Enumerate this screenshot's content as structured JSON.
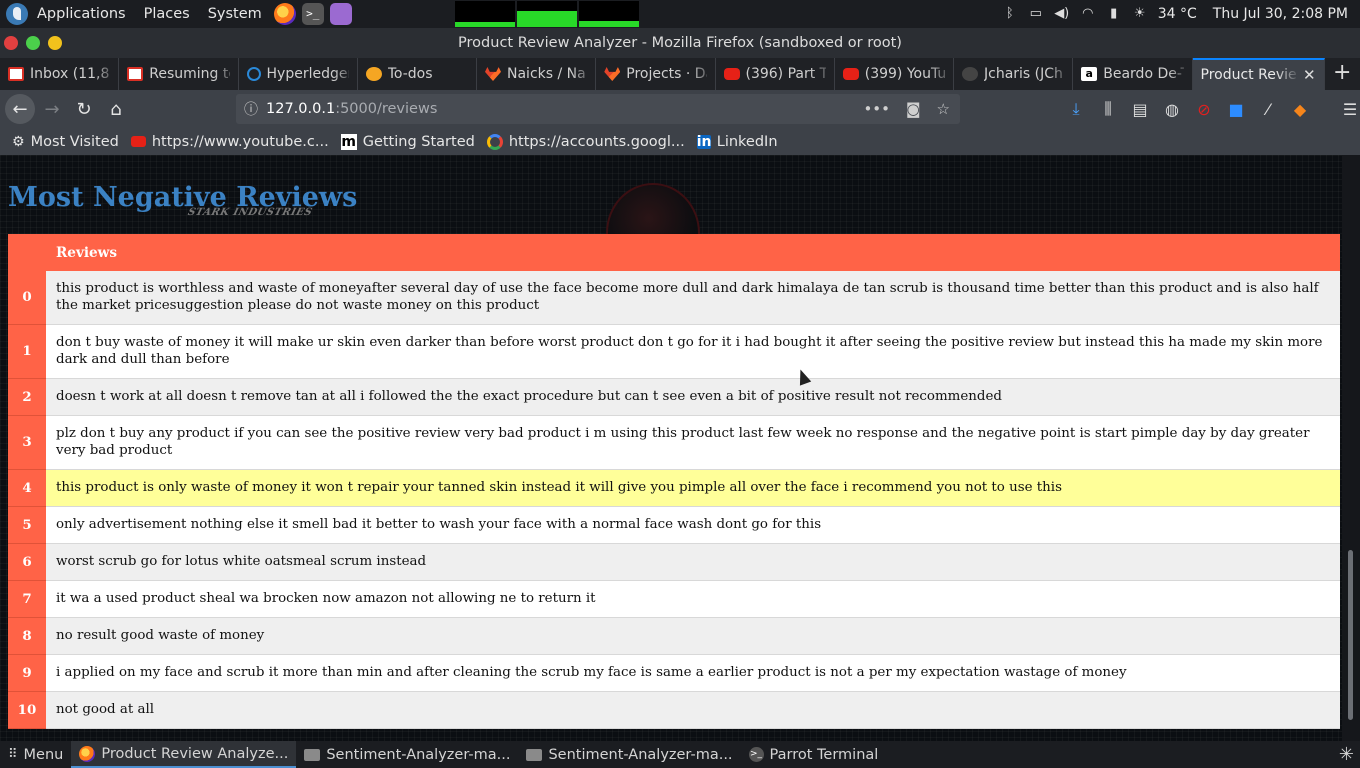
{
  "system_panel": {
    "menus": [
      "Applications",
      "Places",
      "System"
    ],
    "temperature": "34 °C",
    "datetime": "Thu Jul 30,  2:08 PM"
  },
  "window": {
    "title": "Product Review Analyzer - Mozilla Firefox (sandboxed or root)"
  },
  "tabs": [
    {
      "label": "Inbox (11,8",
      "icon": "gmail-icon"
    },
    {
      "label": "Resuming tc",
      "icon": "gmail-icon"
    },
    {
      "label": "Hyperledger",
      "icon": "hyperledger-icon"
    },
    {
      "label": "To-dos",
      "icon": "todo-icon"
    },
    {
      "label": "Naicks / Nai",
      "icon": "gitlab-icon"
    },
    {
      "label": "Projects · Da",
      "icon": "gitlab-icon"
    },
    {
      "label": "(396) Part T",
      "icon": "youtube-icon"
    },
    {
      "label": "(399) YouTu",
      "icon": "youtube-icon"
    },
    {
      "label": "Jcharis (JCh",
      "icon": "github-icon"
    },
    {
      "label": "Beardo De-T",
      "icon": "amazon-icon"
    },
    {
      "label": "Product Revie",
      "icon": "",
      "active": true
    }
  ],
  "navbar": {
    "url_host": "127.0.0.1",
    "url_path": ":5000/reviews"
  },
  "bookmarks": [
    {
      "label": "Most Visited",
      "icon": "gear-icon"
    },
    {
      "label": "https://www.youtube.c...",
      "icon": "youtube-icon"
    },
    {
      "label": "Getting Started",
      "icon": "m-icon"
    },
    {
      "label": "https://accounts.googl...",
      "icon": "google-icon"
    },
    {
      "label": "LinkedIn",
      "icon": "linkedin-icon"
    }
  ],
  "page": {
    "title": "Most Negative Reviews",
    "subtitle": "STARK INDUSTRIES",
    "table_header": {
      "index": "",
      "reviews": "Reviews"
    },
    "rows": [
      {
        "index": "0",
        "text": "this product is worthless and waste of moneyafter several day of use the face become more dull and dark himalaya de tan scrub is thousand time better than this product and is also half the market pricesuggestion please do not waste money on this product"
      },
      {
        "index": "1",
        "text": "don t buy waste of money it will make ur skin even darker than before worst product don t go for it i had bought it after seeing the positive review but instead this ha made my skin more dark and dull than before"
      },
      {
        "index": "2",
        "text": "doesn t work at all doesn t remove tan at all i followed the the exact procedure but can t see even a bit of positive result not recommended"
      },
      {
        "index": "3",
        "text": "plz don t buy any product if you can see the positive review very bad product i m using this product last few week no response and the negative point is start pimple day by day greater very bad product"
      },
      {
        "index": "4",
        "text": "this product is only waste of money it won t repair your tanned skin instead it will give you pimple all over the face i recommend you not to use this",
        "highlight": true
      },
      {
        "index": "5",
        "text": "only advertisement nothing else it smell bad it better to wash your face with a normal face wash dont go for this"
      },
      {
        "index": "6",
        "text": "worst scrub go for lotus white oatsmeal scrum instead"
      },
      {
        "index": "7",
        "text": "it wa a used product sheal wa brocken now amazon not allowing ne to return it"
      },
      {
        "index": "8",
        "text": "no result good waste of money"
      },
      {
        "index": "9",
        "text": "i applied on my face and scrub it more than min and after cleaning the scrub my face is same a earlier product is not a per my expectation wastage of money"
      },
      {
        "index": "10",
        "text": "not good at all"
      }
    ]
  },
  "taskbar": {
    "menu_label": "Menu",
    "tasks": [
      {
        "label": "Product Review Analyze...",
        "active": true
      },
      {
        "label": "Sentiment-Analyzer-ma..."
      },
      {
        "label": "Sentiment-Analyzer-ma..."
      },
      {
        "label": "Parrot Terminal"
      }
    ]
  },
  "colors": {
    "table_accent": "#ff6347",
    "title_blue": "#3b82c4",
    "highlight_row": "#ffff99",
    "firefox_blue": "#0a84ff"
  }
}
